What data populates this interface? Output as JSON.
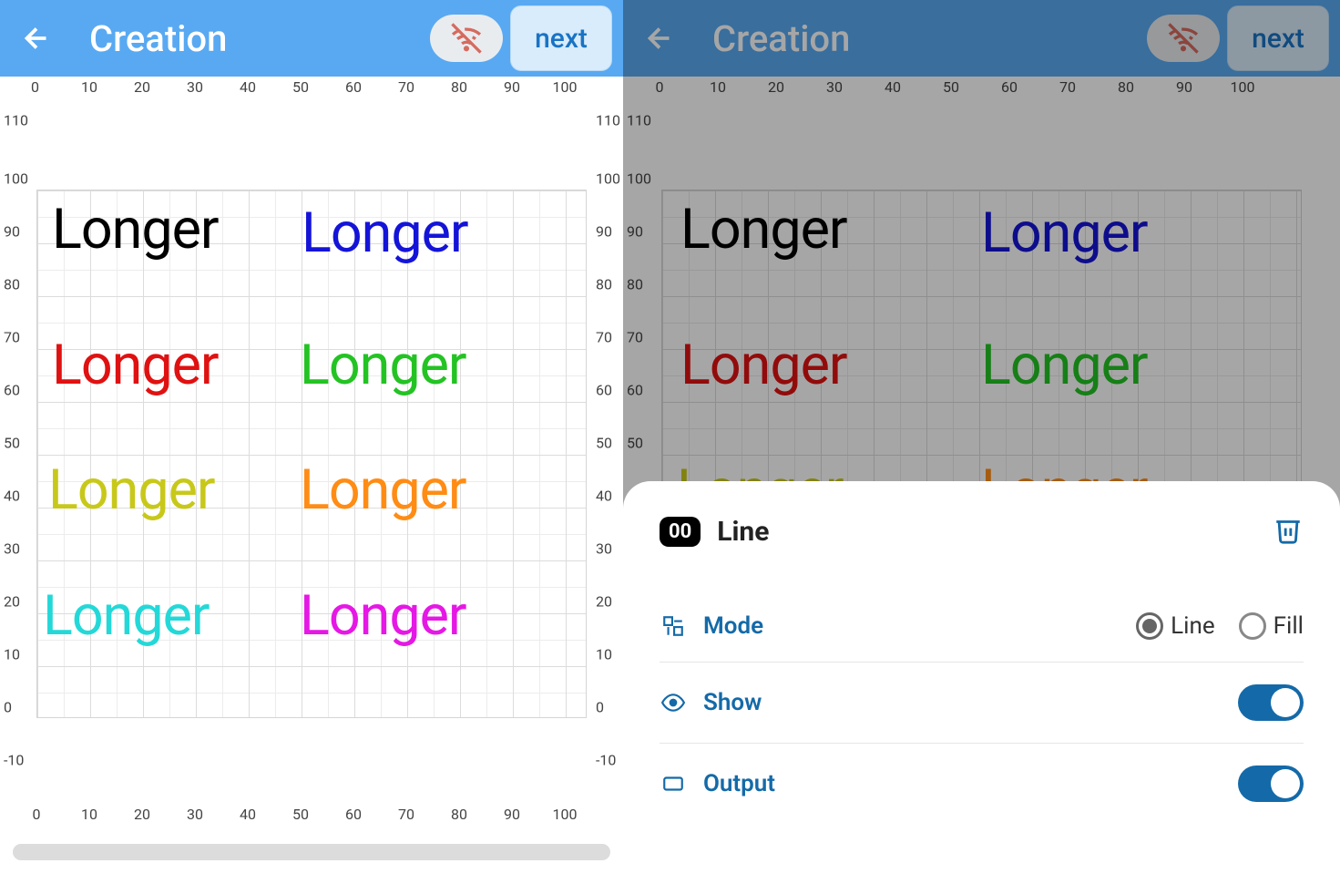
{
  "header": {
    "title": "Creation",
    "next_label": "next"
  },
  "ruler": {
    "top": [
      "0",
      "10",
      "20",
      "30",
      "40",
      "50",
      "60",
      "70",
      "80",
      "90",
      "100"
    ],
    "bottom": [
      "0",
      "10",
      "20",
      "30",
      "40",
      "50",
      "60",
      "70",
      "80",
      "90",
      "100"
    ],
    "left": [
      "110",
      "100",
      "90",
      "80",
      "70",
      "60",
      "50",
      "40",
      "30",
      "20",
      "10",
      "0",
      "-10"
    ],
    "right": [
      "110",
      "100",
      "90",
      "80",
      "70",
      "60",
      "50",
      "40",
      "30",
      "20",
      "10",
      "0",
      "-10"
    ]
  },
  "canvas": {
    "items": [
      {
        "text": "Longer",
        "color": "#000000"
      },
      {
        "text": "Longer",
        "color": "#1414d8"
      },
      {
        "text": "Longer",
        "color": "#e01111"
      },
      {
        "text": "Longer",
        "color": "#23c323"
      },
      {
        "text": "Longer",
        "color": "#c8c81a"
      },
      {
        "text": "Longer",
        "color": "#ff8c14"
      },
      {
        "text": "Longer",
        "color": "#24d8d8"
      },
      {
        "text": "Longer",
        "color": "#e518e5"
      }
    ]
  },
  "sheet": {
    "badge": "00",
    "title": "Line",
    "rows": {
      "mode": {
        "label": "Mode",
        "opt1": "Line",
        "opt2": "Fill",
        "selected": "Line"
      },
      "show": {
        "label": "Show",
        "on": true
      },
      "output": {
        "label": "Output",
        "on": true
      }
    }
  }
}
